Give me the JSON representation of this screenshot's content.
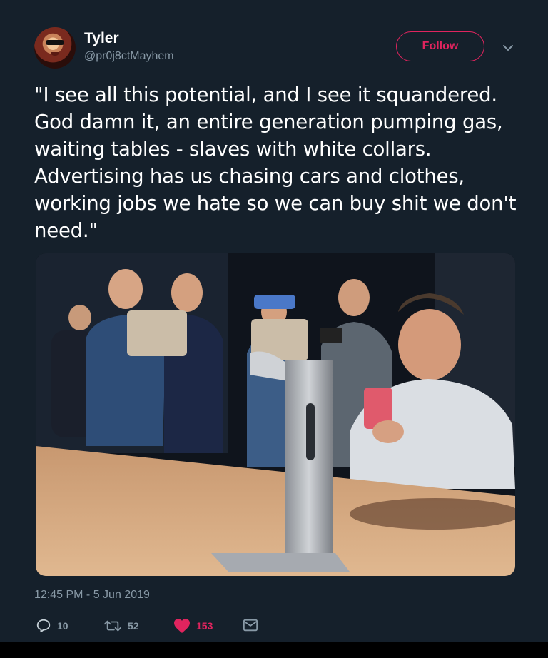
{
  "user": {
    "name": "Tyler",
    "handle": "@pr0j8ctMayhem"
  },
  "follow": {
    "label": "Follow"
  },
  "tweet": {
    "text": "\"I see all this potential, and I see it squandered. God damn it, an entire generation pumping gas, waiting tables - slaves with white collars. Advertising has us chasing cars and clothes, working jobs we hate so we can buy shit we don't need.\"",
    "timestamp": "12:45 PM - 5 Jun 2019"
  },
  "actions": {
    "replies": "10",
    "retweets": "52",
    "likes": "153"
  },
  "icons": {
    "reply": "speech-bubble-icon",
    "retweet": "retweet-arrows-icon",
    "like": "heart-icon",
    "dm": "envelope-icon",
    "more": "chevron-down-icon"
  },
  "colors": {
    "background": "#15202b",
    "accent": "#e0245e",
    "muted": "#8899a6"
  }
}
